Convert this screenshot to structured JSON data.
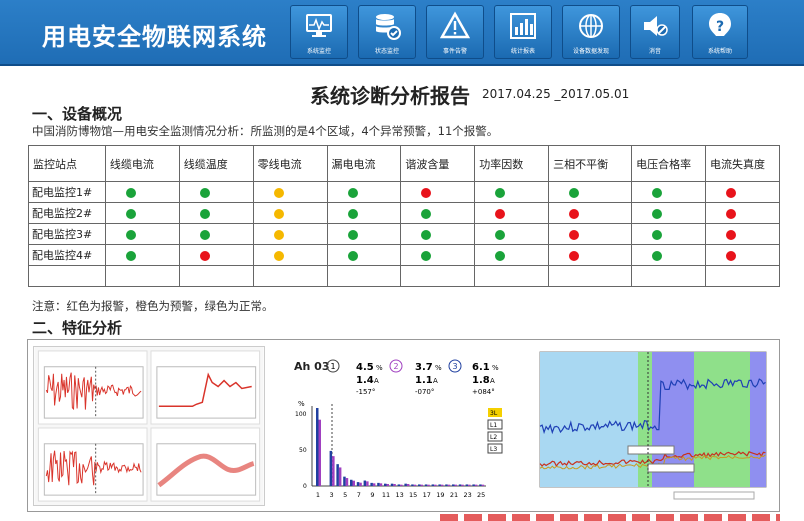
{
  "app": {
    "title": "用电安全物联网系统"
  },
  "nav": [
    {
      "label": "系统监控",
      "icon": "monitor-icon"
    },
    {
      "label": "状态监控",
      "icon": "database-icon"
    },
    {
      "label": "事件告警",
      "icon": "warning-icon"
    },
    {
      "label": "统计报表",
      "icon": "bar-chart-icon"
    },
    {
      "label": "设备数据发现",
      "icon": "globe-icon"
    },
    {
      "label": "消音",
      "icon": "mute-icon"
    },
    {
      "label": "系统帮助",
      "icon": "help-icon"
    }
  ],
  "report": {
    "title": "系统诊断分析报告",
    "date": "2017.04.25 _2017.05.01",
    "section1": "一、设备概况",
    "summary": "中国消防博物馆—用电安全监测情况分析：所监测的是4个区域，4个异常预警，11个报警。",
    "note": "注意：红色为报警，橙色为预警，绿色为正常。",
    "section2": "二、特征分析"
  },
  "colors": {
    "green": "#1aa33a",
    "red": "#e8131b",
    "orange": "#f5b800"
  },
  "table": {
    "headers": [
      "监控站点",
      "线缆电流",
      "线缆温度",
      "零线电流",
      "漏电电流",
      "谐波含量",
      "功率因数",
      "三相不平衡",
      "电压合格率",
      "电流失真度"
    ],
    "rows": [
      {
        "station": "配电监控1#",
        "status": [
          "green",
          "green",
          "orange",
          "green",
          "red",
          "green",
          "green",
          "green",
          "red"
        ]
      },
      {
        "station": "配电监控2#",
        "status": [
          "green",
          "green",
          "orange",
          "green",
          "green",
          "red",
          "red",
          "green",
          "red"
        ]
      },
      {
        "station": "配电监控3#",
        "status": [
          "green",
          "green",
          "orange",
          "green",
          "green",
          "green",
          "red",
          "green",
          "red"
        ]
      },
      {
        "station": "配电监控4#",
        "status": [
          "green",
          "red",
          "orange",
          "green",
          "green",
          "green",
          "red",
          "green",
          "red"
        ]
      }
    ]
  },
  "harmonics": {
    "header_label": "Ah 03",
    "phases": [
      {
        "id": "1",
        "pct": "4.5",
        "amp": "1.4",
        "deg": "-157°"
      },
      {
        "id": "2",
        "pct": "3.7",
        "amp": "1.1",
        "deg": "-070°"
      },
      {
        "id": "3",
        "pct": "6.1",
        "amp": "1.8",
        "deg": "+084°"
      }
    ],
    "legend": [
      "3L",
      "L1",
      "L2",
      "L3"
    ],
    "x_ticks": [
      "1",
      "3",
      "5",
      "7",
      "9",
      "11",
      "13",
      "15",
      "17",
      "19",
      "21",
      "23",
      "25"
    ],
    "y_ticks": [
      "100",
      "50",
      "0"
    ],
    "y_unit": "%"
  }
}
